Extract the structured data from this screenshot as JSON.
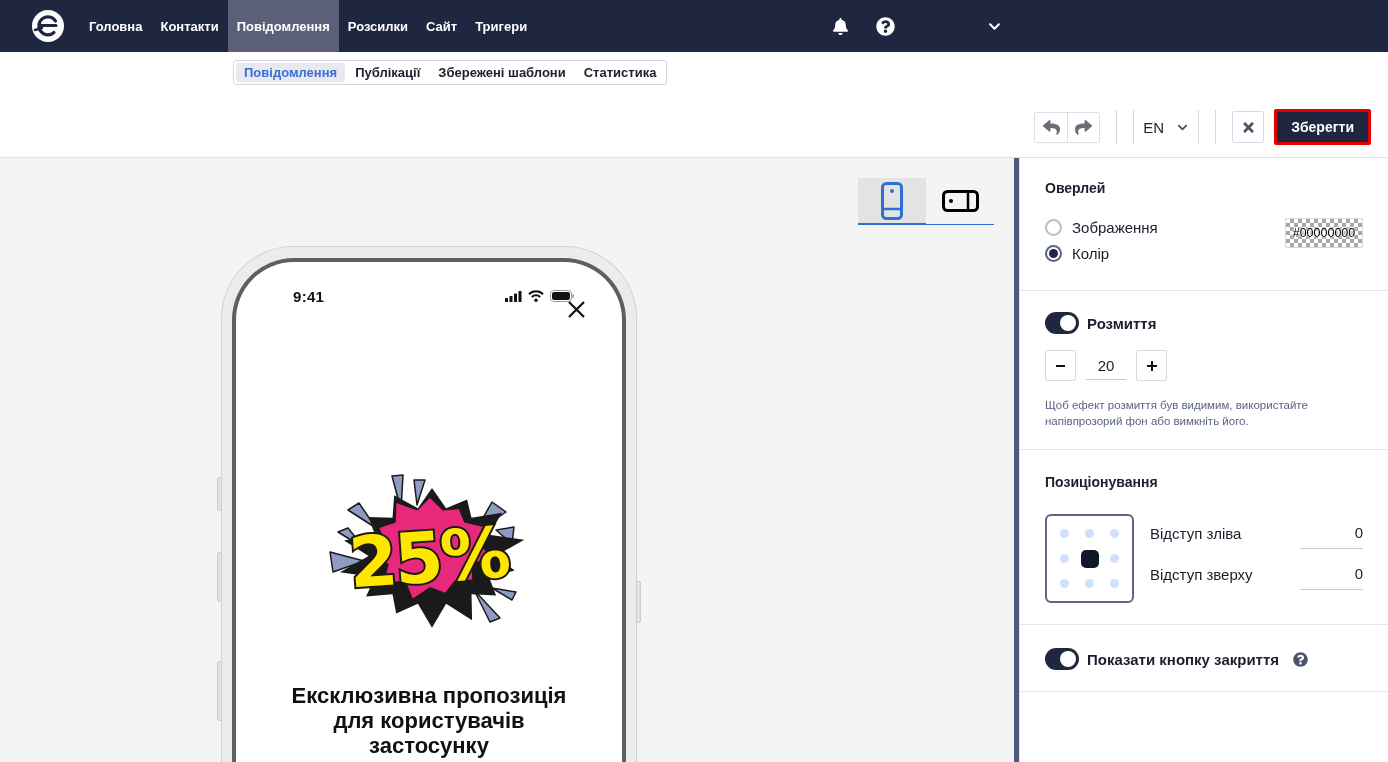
{
  "top_nav": {
    "items": [
      {
        "label": "Головна",
        "selected": false
      },
      {
        "label": "Контакти",
        "selected": false
      },
      {
        "label": "Повідомлення",
        "selected": true
      },
      {
        "label": "Розсилки",
        "selected": false
      },
      {
        "label": "Сайт",
        "selected": false
      },
      {
        "label": "Тригери",
        "selected": false
      }
    ]
  },
  "sub_tabs": [
    {
      "label": "Повідомлення",
      "selected": true
    },
    {
      "label": "Публікації",
      "selected": false
    },
    {
      "label": "Збережені шаблони",
      "selected": false
    },
    {
      "label": "Статистика",
      "selected": false
    }
  ],
  "toolbar": {
    "language": "EN",
    "save_label": "Зберегти"
  },
  "device_tabs": [
    {
      "kind": "portrait",
      "selected": true
    },
    {
      "kind": "landscape",
      "selected": false
    }
  ],
  "preview": {
    "status_time": "9:41",
    "badge_text": "25%",
    "title": "Ексклюзивна пропозиція для користувачів застосунку"
  },
  "settings": {
    "overlay": {
      "title": "Оверлей",
      "options": [
        {
          "label": "Зображення",
          "selected": false
        },
        {
          "label": "Колір",
          "selected": true
        }
      ],
      "color_value": "#00000000"
    },
    "blur": {
      "label": "Розмиття",
      "on": true,
      "value": "20",
      "hint": "Щоб ефект розмиття був видимим, використайте напівпрозорий фон або вимкніть його."
    },
    "positioning": {
      "title": "Позиціонування",
      "anchors": [
        {
          "selected": false
        },
        {
          "selected": false
        },
        {
          "selected": false
        },
        {
          "selected": false
        },
        {
          "selected": true
        },
        {
          "selected": false
        },
        {
          "selected": false
        },
        {
          "selected": false
        },
        {
          "selected": false
        }
      ],
      "fields": [
        {
          "label": "Відступ зліва",
          "value": "0"
        },
        {
          "label": "Відступ зверху",
          "value": "0"
        }
      ]
    },
    "close_button": {
      "label": "Показати кнопку закриття",
      "on": true
    }
  }
}
